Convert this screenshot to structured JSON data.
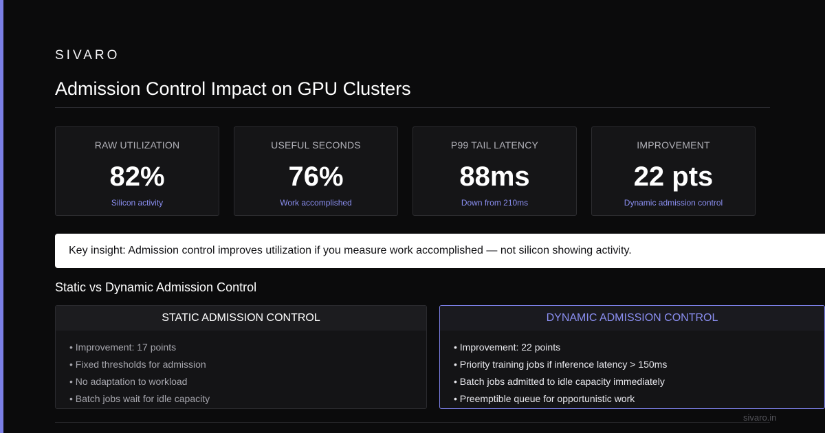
{
  "brand": "SIVARO",
  "title": "Admission Control Impact on GPU Clusters",
  "metrics": [
    {
      "label": "RAW UTILIZATION",
      "value": "82%",
      "sub": "Silicon activity"
    },
    {
      "label": "USEFUL SECONDS",
      "value": "76%",
      "sub": "Work accomplished"
    },
    {
      "label": "P99 TAIL LATENCY",
      "value": "88ms",
      "sub": "Down from 210ms"
    },
    {
      "label": "IMPROVEMENT",
      "value": "22 pts",
      "sub": "Dynamic admission control"
    }
  ],
  "insight": "Key insight: Admission control improves utilization if you measure work accomplished — not silicon showing activity.",
  "section_title": "Static vs Dynamic Admission Control",
  "static": {
    "title": "STATIC ADMISSION CONTROL",
    "items": [
      "• Improvement: 17 points",
      "• Fixed thresholds for admission",
      "• No adaptation to workload",
      "• Batch jobs wait for idle capacity"
    ]
  },
  "dynamic": {
    "title": "DYNAMIC ADMISSION CONTROL",
    "items": [
      "• Improvement: 22 points",
      "• Priority training jobs if inference latency > 150ms",
      "• Batch jobs admitted to idle capacity immediately",
      "• Preemptible queue for opportunistic work"
    ]
  },
  "footer": "sivaro.in",
  "colors": {
    "accent": "#7b7fe6",
    "background": "#0b0b0c",
    "card": "#151517"
  }
}
